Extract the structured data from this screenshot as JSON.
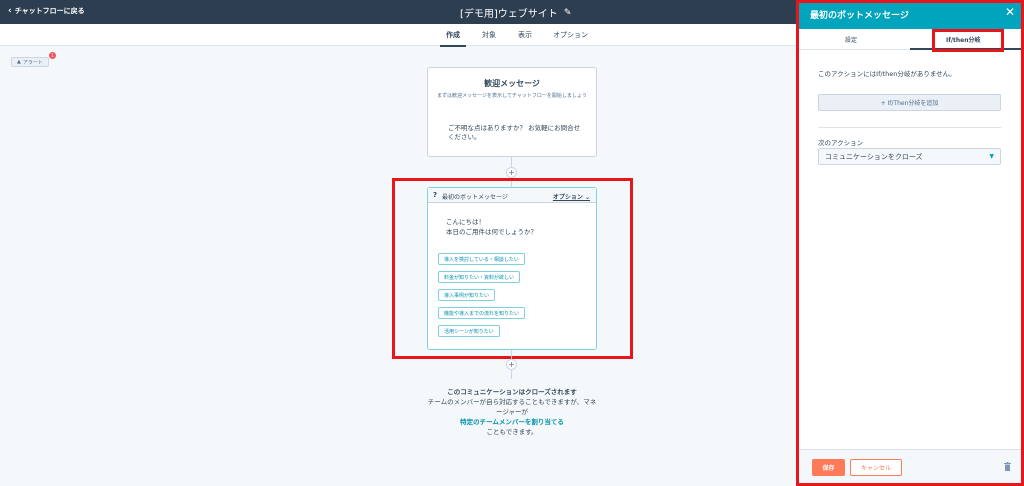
{
  "topbar": {
    "back_label": "チャットフローに戻る",
    "title": "[デモ用]ウェブサイト"
  },
  "tabs": [
    {
      "label": "作成",
      "active": true
    },
    {
      "label": "対象",
      "active": false
    },
    {
      "label": "表示",
      "active": false
    },
    {
      "label": "オプション",
      "active": false
    }
  ],
  "alert": {
    "label": "アラート",
    "count": "1"
  },
  "welcome_card": {
    "title": "歓迎メッセージ",
    "subtitle": "まずは歓迎メッセージを表示してチャットフローを開始しましょう",
    "message": "ご不明な点はありますか？ お気軽にお問合せください。"
  },
  "bot_card": {
    "icon": "?",
    "title": "最初のボットメッセージ",
    "options_label": "オプション ⌄",
    "greeting_line1": "こんにちは！",
    "greeting_line2": "本日のご用件は何でしょうか？",
    "replies": [
      "導入を検討している・相談したい",
      "料金が知りたい・資料が欲しい",
      "導入事例が知りたい",
      "機能や導入までの流れを知りたい",
      "活用シーンが知りたい"
    ]
  },
  "end_block": {
    "title": "このコミュニケーションはクローズされます",
    "line1": "チームのメンバーが自ら対応することもできますが、マネ",
    "line2": "ージャーが",
    "link": "特定のチームメンバーを割り当てる",
    "line3": "こともできます。"
  },
  "panel": {
    "title": "最初のボットメッセージ",
    "tabs": [
      {
        "label": "設定",
        "active": false
      },
      {
        "label": "If/then分岐",
        "active": true
      }
    ],
    "note": "このアクションにはIf/then分岐がありません。",
    "add_branch_label": "+ If/Then分岐を追加",
    "next_action_label": "次のアクション",
    "next_action_value": "コミュニケーションをクローズ",
    "save_label": "保存",
    "cancel_label": "キャンセル"
  },
  "colors": {
    "topbar": "#2d3e50",
    "accent": "#00a4bd",
    "primary_button": "#ff7a59",
    "highlight": "#e8161b"
  }
}
